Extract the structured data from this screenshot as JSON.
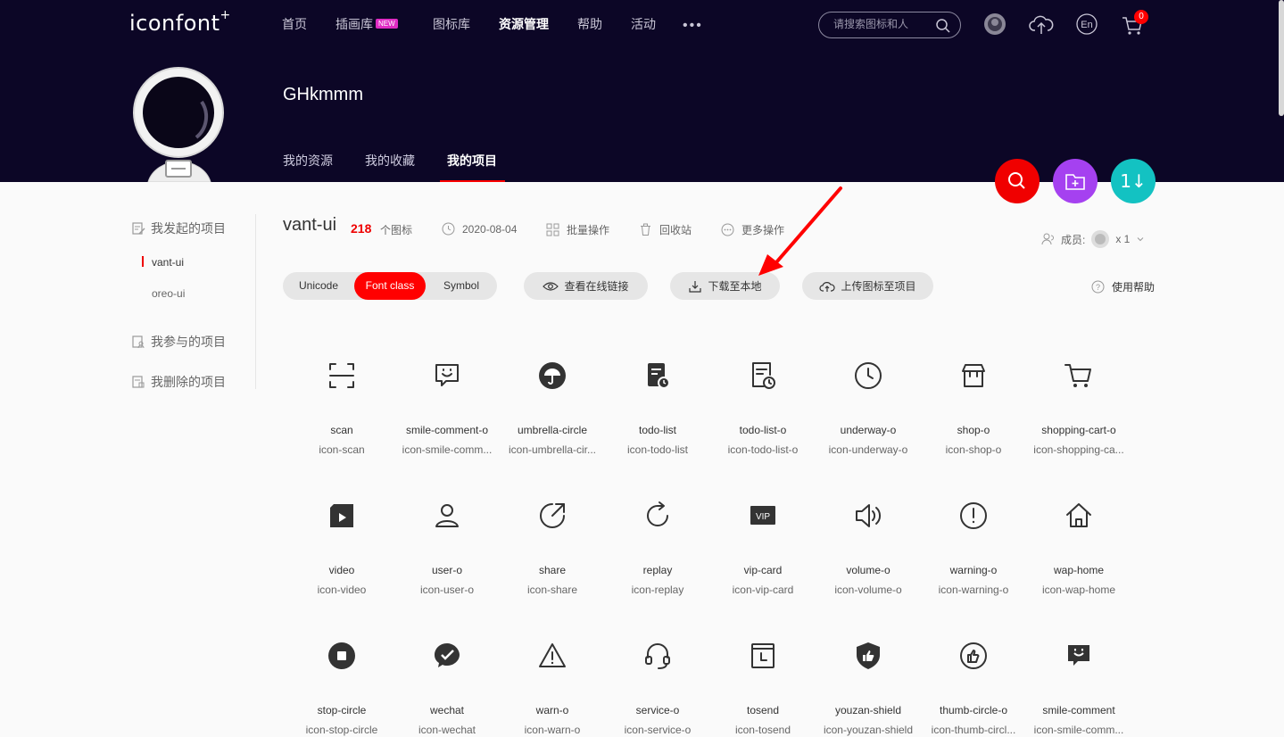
{
  "brand": {
    "logo_text": "iconfont",
    "logo_plus": "+"
  },
  "nav": {
    "items": [
      {
        "label": "首页"
      },
      {
        "label": "插画库",
        "badge": "NEW"
      },
      {
        "label": "图标库"
      },
      {
        "label": "资源管理",
        "active": true
      },
      {
        "label": "帮助"
      },
      {
        "label": "活动"
      }
    ],
    "more": "•••"
  },
  "search": {
    "placeholder": "请搜索图标和人"
  },
  "header_icons": [
    "user-avatar-icon",
    "upload-cloud-icon",
    "language-en-icon",
    "cart-icon"
  ],
  "language_label": "En",
  "cart": {
    "count": "0"
  },
  "profile": {
    "username": "GHkmmm"
  },
  "profile_tabs": [
    {
      "label": "我的资源"
    },
    {
      "label": "我的收藏"
    },
    {
      "label": "我的项目",
      "active": true
    }
  ],
  "fab": {
    "colors": {
      "search": "#f00000",
      "folder": "#a541f0",
      "sort": "#13c2c2"
    },
    "sort_glyph": "1↓"
  },
  "sidebar": {
    "groups": [
      {
        "label": "我发起的项目",
        "items": [
          {
            "label": "vant-ui",
            "active": true
          },
          {
            "label": "oreo-ui"
          }
        ]
      },
      {
        "label": "我参与的项目",
        "items": []
      },
      {
        "label": "我删除的项目",
        "items": []
      }
    ]
  },
  "project": {
    "name": "vant-ui",
    "count": "218",
    "count_unit": "个图标",
    "date": "2020-08-04",
    "batch": "批量操作",
    "recycle": "回收站",
    "more": "更多操作",
    "members_label": "成员:",
    "members_count": "x 1"
  },
  "toolbar": {
    "modes": [
      {
        "label": "Unicode"
      },
      {
        "label": "Font class",
        "active": true
      },
      {
        "label": "Symbol"
      }
    ],
    "view_link": "查看在线链接",
    "download": "下载至本地",
    "upload": "上传图标至项目",
    "help": "使用帮助"
  },
  "icons": [
    {
      "name": "scan",
      "cls": "icon-scan",
      "icon": "scan-icon"
    },
    {
      "name": "smile-comment-o",
      "cls": "icon-smile-comm...",
      "icon": "smile-comment-o-icon"
    },
    {
      "name": "umbrella-circle",
      "cls": "icon-umbrella-cir...",
      "icon": "umbrella-circle-icon"
    },
    {
      "name": "todo-list",
      "cls": "icon-todo-list",
      "icon": "todo-list-icon"
    },
    {
      "name": "todo-list-o",
      "cls": "icon-todo-list-o",
      "icon": "todo-list-o-icon"
    },
    {
      "name": "underway-o",
      "cls": "icon-underway-o",
      "icon": "underway-o-icon"
    },
    {
      "name": "shop-o",
      "cls": "icon-shop-o",
      "icon": "shop-o-icon"
    },
    {
      "name": "shopping-cart-o",
      "cls": "icon-shopping-ca...",
      "icon": "shopping-cart-o-icon"
    },
    {
      "name": "video",
      "cls": "icon-video",
      "icon": "video-icon"
    },
    {
      "name": "user-o",
      "cls": "icon-user-o",
      "icon": "user-o-icon"
    },
    {
      "name": "share",
      "cls": "icon-share",
      "icon": "share-icon"
    },
    {
      "name": "replay",
      "cls": "icon-replay",
      "icon": "replay-icon"
    },
    {
      "name": "vip-card",
      "cls": "icon-vip-card",
      "icon": "vip-card-icon"
    },
    {
      "name": "volume-o",
      "cls": "icon-volume-o",
      "icon": "volume-o-icon"
    },
    {
      "name": "warning-o",
      "cls": "icon-warning-o",
      "icon": "warning-o-icon"
    },
    {
      "name": "wap-home",
      "cls": "icon-wap-home",
      "icon": "wap-home-icon"
    },
    {
      "name": "stop-circle",
      "cls": "icon-stop-circle",
      "icon": "stop-circle-icon"
    },
    {
      "name": "wechat",
      "cls": "icon-wechat",
      "icon": "wechat-icon"
    },
    {
      "name": "warn-o",
      "cls": "icon-warn-o",
      "icon": "warn-o-icon"
    },
    {
      "name": "service-o",
      "cls": "icon-service-o",
      "icon": "service-o-icon"
    },
    {
      "name": "tosend",
      "cls": "icon-tosend",
      "icon": "tosend-icon"
    },
    {
      "name": "youzan-shield",
      "cls": "icon-youzan-shield",
      "icon": "youzan-shield-icon"
    },
    {
      "name": "thumb-circle-o",
      "cls": "icon-thumb-circl...",
      "icon": "thumb-circle-o-icon"
    },
    {
      "name": "smile-comment",
      "cls": "icon-smile-comm...",
      "icon": "smile-comment-icon"
    }
  ],
  "vip_text": "VIP",
  "colors": {
    "header_bg": "#0c0626",
    "accent": "#f00000",
    "badge_new": "#e02cc4"
  }
}
